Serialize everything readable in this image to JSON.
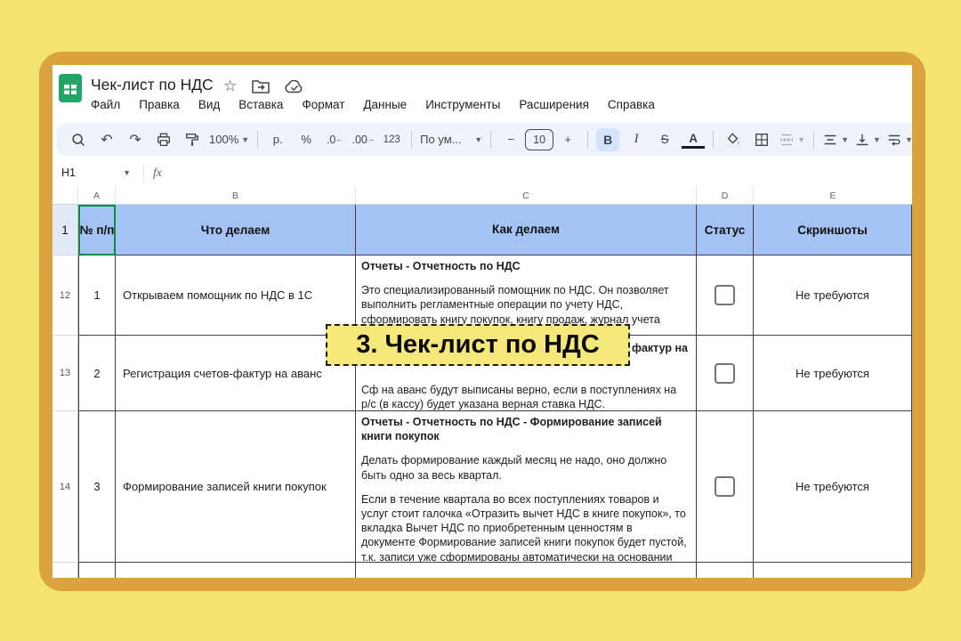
{
  "slide": {
    "overlay_title": "3. Чек-лист по НДС"
  },
  "app": {
    "doc_title": "Чек-лист по НДС",
    "menus": [
      "Файл",
      "Правка",
      "Вид",
      "Вставка",
      "Формат",
      "Данные",
      "Инструменты",
      "Расширения",
      "Справка"
    ],
    "toolbar": {
      "zoom": "100%",
      "currency": "р.",
      "percent": "%",
      "decrease_decimals": ".0",
      "increase_decimals": ".00",
      "more_formats": "123",
      "font_name": "По ум...",
      "font_size": "10",
      "minus": "−",
      "plus": "+",
      "bold": "B",
      "italic": "I",
      "strikethrough": "S",
      "text_color": "A"
    },
    "name_box": "H1",
    "formula_fx": "fx",
    "column_letters": [
      "A",
      "B",
      "C",
      "D",
      "E"
    ],
    "colors": {
      "header_fill": "#A4C2F4",
      "frame": "#DCA23F",
      "background": "#F3E372",
      "overlay_fill": "#F5E87A",
      "logo_green": "#23A566",
      "bold_active_fill": "#D2E3FC"
    }
  },
  "sheet": {
    "header_row": {
      "num": "1",
      "cells": {
        "a": "№ п/п",
        "b": "Что делаем",
        "c": "Как делаем",
        "d": "Статус",
        "e": "Скриншоты"
      }
    },
    "rows": [
      {
        "num": "12",
        "a": "1",
        "b": "Открываем помощник по НДС в 1С",
        "c_heading": "Отчеты - Отчетность по НДС",
        "c_para1": "Это специализированный помощник по НДС. Он позволяет выполнить регламентные операции по учету НДС, сформировать книгу покупок, книгу продаж, журнал учета",
        "status_checked": false,
        "e": "Не требуются"
      },
      {
        "num": "13",
        "a": "2",
        "b": "Регистрация счетов-фактур на аванс",
        "c_heading_fragment": "фактур на",
        "c_para1": "Сф на аванс будут выписаны верно, если в поступлениях на р/с (в кассу) будет указана верная ставка НДС.",
        "status_checked": false,
        "e": "Не требуются"
      },
      {
        "num": "14",
        "a": "3",
        "b": "Формирование записей книги покупок",
        "c_heading": "Отчеты - Отчетность по НДС - Формирование записей книги покупок",
        "c_para1": "Делать формирование каждый месяц не надо, оно должно быть одно за весь квартал.",
        "c_para2": "Если в течение квартала во всех поступлениях товаров и услуг стоит галочка «Отразить вычет НДС в книге покупок», то вкладка Вычет НДС по приобретенным ценностям в документе Формирование записей книги покупок будет пустой, т.к. записи уже сформированы автоматически на основании поступлений.",
        "status_checked": false,
        "e": "Не требуются"
      }
    ]
  }
}
